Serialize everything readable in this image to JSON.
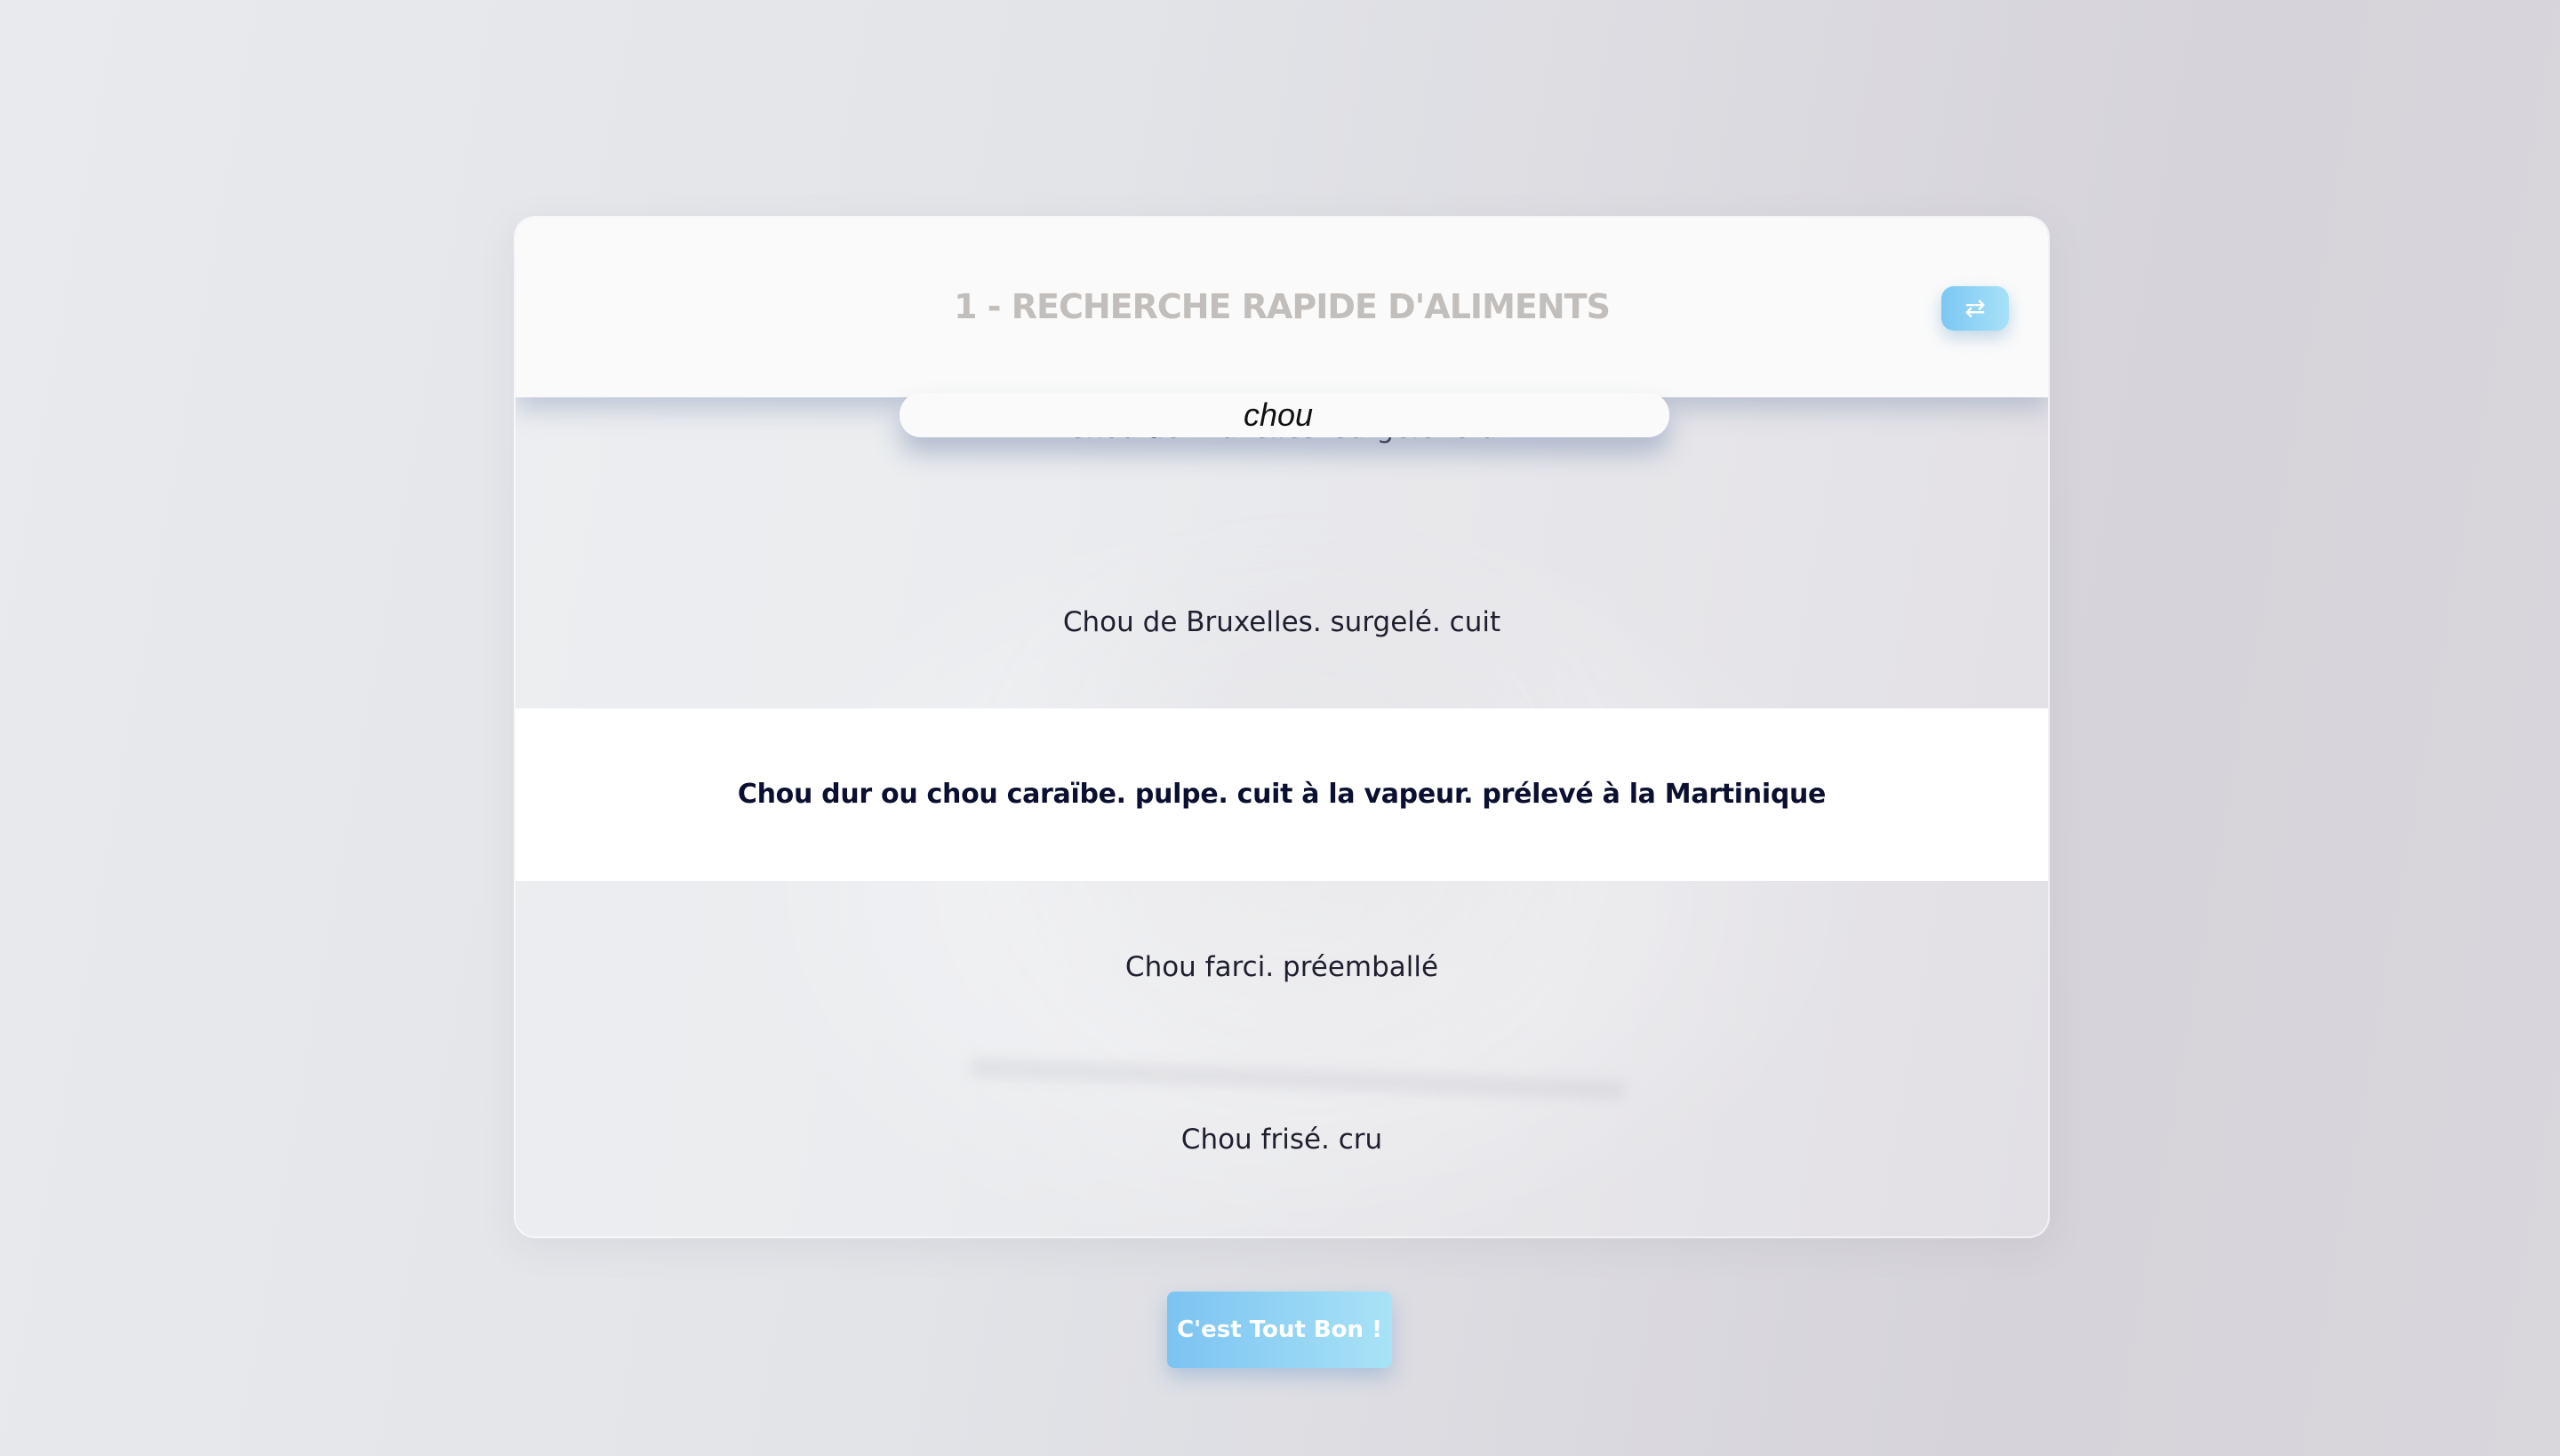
{
  "header": {
    "title": "1 - RECHERCHE RAPIDE D'ALIMENTS",
    "swap_icon": "swap-arrows-icon",
    "swap_glyph": "⇄"
  },
  "search": {
    "value": "chou",
    "placeholder": ""
  },
  "results": {
    "items": [
      {
        "label": "Chou de Bruxelles. surgelé. cru",
        "selected": false
      },
      {
        "label": "Chou de Bruxelles. surgelé. cuit",
        "selected": false
      },
      {
        "label": "Chou dur ou chou caraïbe. pulpe. cuit à la vapeur. prélevé à la Martinique",
        "selected": true
      },
      {
        "label": "Chou farci. préemballé",
        "selected": false
      },
      {
        "label": "Chou frisé. cru",
        "selected": false
      }
    ]
  },
  "footer": {
    "confirm_label": "C'est Tout Bon !"
  },
  "colors": {
    "accent_start": "#7cc3f2",
    "accent_end": "#a8e3f6",
    "title": "#c2bebb",
    "selected_text": "#0b1030"
  }
}
